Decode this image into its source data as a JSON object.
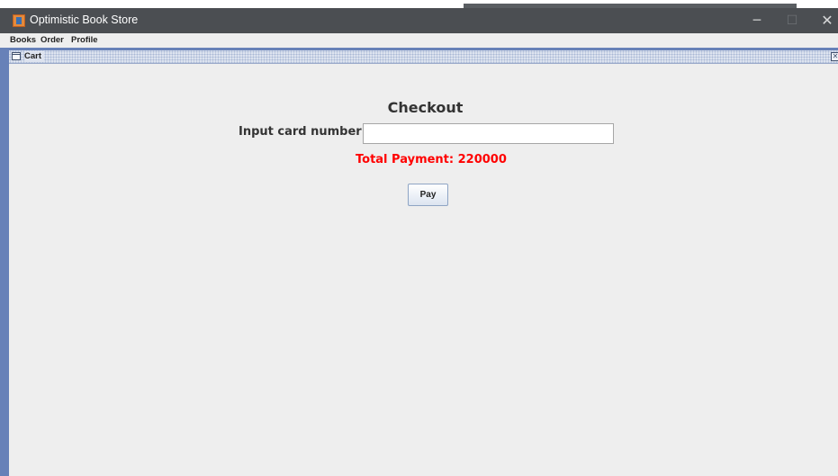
{
  "window": {
    "title": "Optimistic Book Store",
    "minimize_glyph": "─",
    "maximize_glyph": "☐",
    "close_glyph": "✕"
  },
  "menubar": {
    "items": [
      {
        "label": "Books"
      },
      {
        "label": "Order"
      },
      {
        "label": "Profile"
      }
    ]
  },
  "internal_frame": {
    "title": "Cart",
    "close_glyph": "✕"
  },
  "checkout": {
    "heading": "Checkout",
    "card_label": "Input card number:",
    "card_value": "",
    "total_payment": "Total Payment: 220000",
    "pay_label": "Pay"
  },
  "colors": {
    "titlebar": "#4b4e52",
    "desktop": "#6781b8",
    "panel": "#eeeeee",
    "total_payment": "#ff0000"
  },
  "icons": {
    "app": "java-cup-icon",
    "frame": "window-icon",
    "frame_close": "close-icon"
  }
}
